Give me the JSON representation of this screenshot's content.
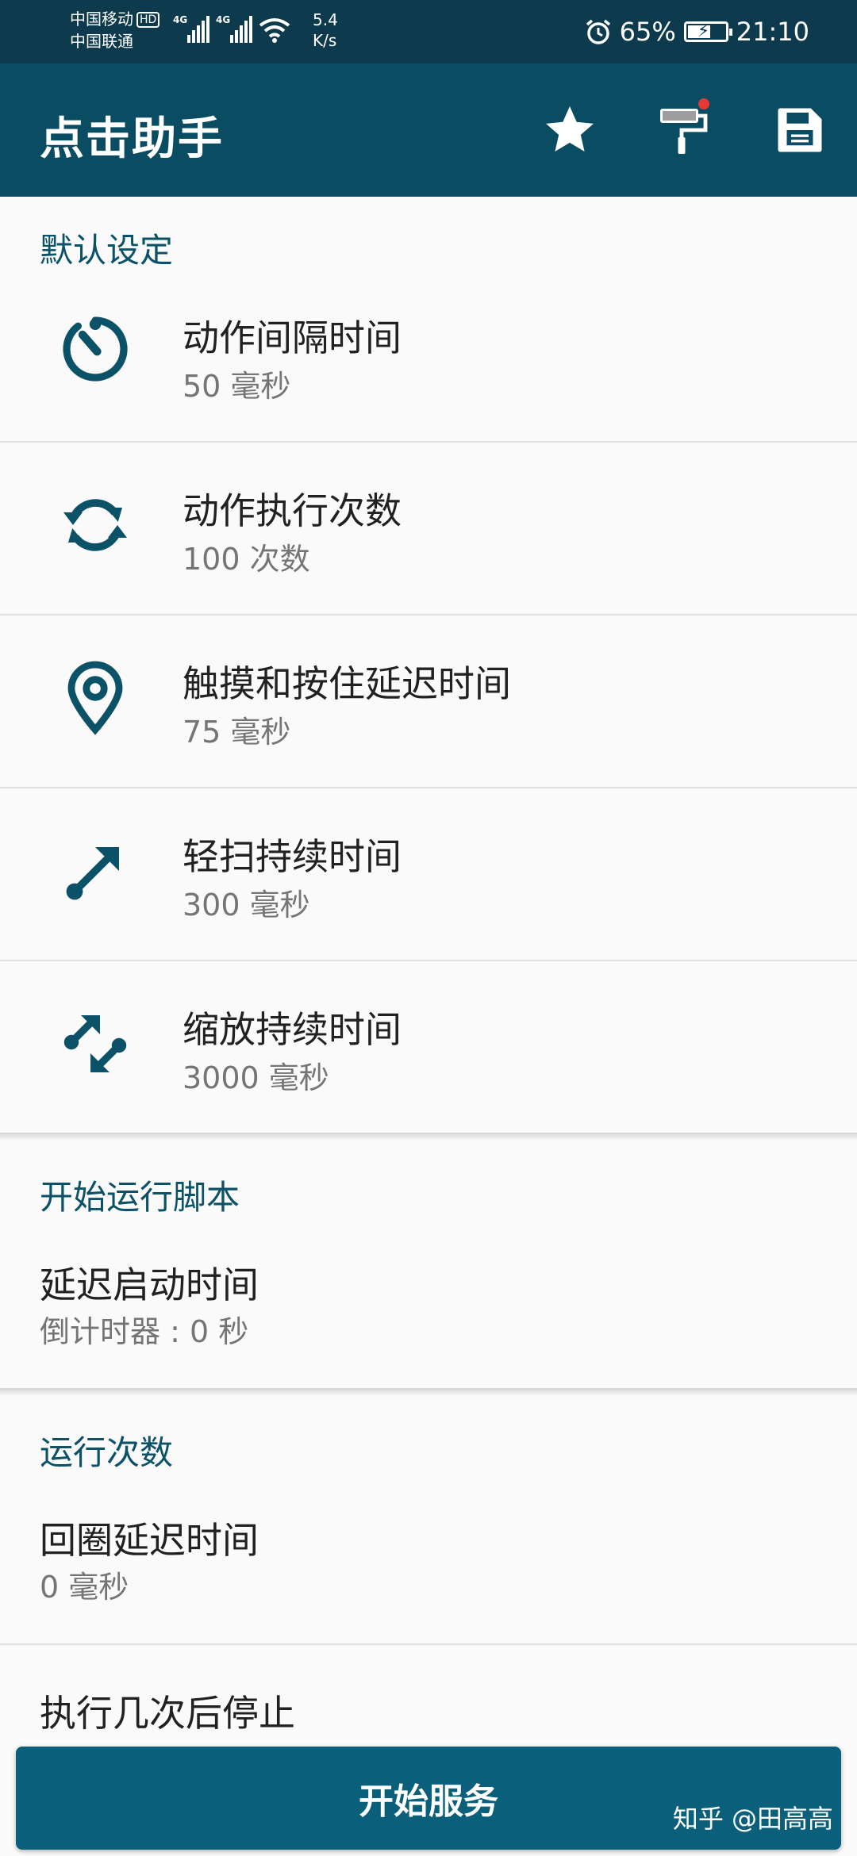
{
  "status_bar": {
    "carrier1": "中国移动",
    "hd": "HD",
    "carrier2": "中国联通",
    "net1": "4G",
    "net2": "4G",
    "speed_value": "5.4",
    "speed_unit": "K/s",
    "battery_percent": "65%",
    "battery_level": 0.65,
    "time": "21:10"
  },
  "app_bar": {
    "title": "点击助手"
  },
  "icons": {
    "star": "star-icon",
    "paint": "paint-roller-icon",
    "save": "save-icon",
    "timer": "timer-icon",
    "repeat": "repeat-icon",
    "location": "location-pin-icon",
    "swipe": "swipe-arrow-icon",
    "zoom": "zoom-arrows-icon"
  },
  "colors": {
    "primary": "#0a4d63",
    "accent": "#0b5168",
    "button": "#0a5f7a"
  },
  "default_settings": {
    "header": "默认设定",
    "items": [
      {
        "title": "动作间隔时间",
        "value": "50 毫秒"
      },
      {
        "title": "动作执行次数",
        "value": "100 次数"
      },
      {
        "title": "触摸和按住延迟时间",
        "value": "75 毫秒"
      },
      {
        "title": "轻扫持续时间",
        "value": "300 毫秒"
      },
      {
        "title": "缩放持续时间",
        "value": "3000 毫秒"
      }
    ]
  },
  "start_script": {
    "header": "开始运行脚本",
    "delay_title": "延迟启动时间",
    "delay_value": "倒计时器 : 0 秒"
  },
  "run_count": {
    "header": "运行次数",
    "loop_title": "回圈延迟时间",
    "loop_value": "0 毫秒",
    "stop_title": "执行几次后停止"
  },
  "start_button": "开始服务",
  "watermark": "知乎 @田高高"
}
